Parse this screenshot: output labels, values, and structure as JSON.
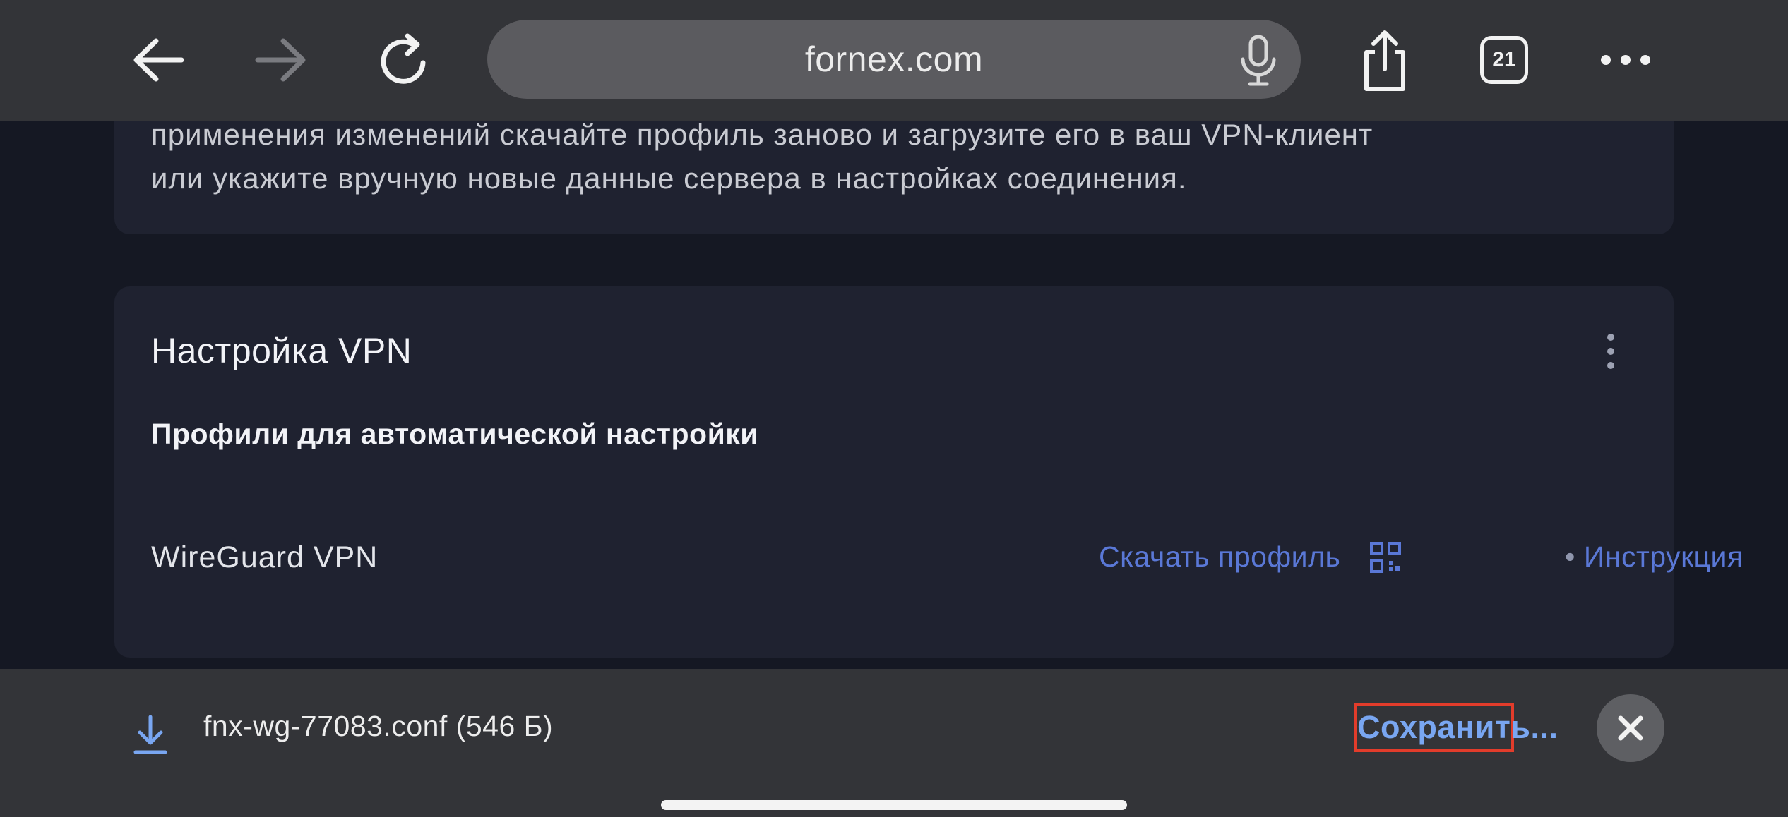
{
  "toolbar": {
    "url": "fornex.com",
    "tab_count": "21",
    "icons": [
      "back-arrow-icon",
      "forward-arrow-icon",
      "reload-icon",
      "microphone-icon",
      "share-icon",
      "tabs-icon",
      "more-icon"
    ]
  },
  "notice": {
    "text_line1": "применения изменений скачайте профиль заново и загрузите его в ваш VPN-клиент",
    "text_line2": "или укажите вручную новые данные сервера в настройках соединения."
  },
  "vpn_card": {
    "title": "Настройка VPN",
    "subtitle": "Профили для автоматической настройки",
    "row": {
      "name": "WireGuard VPN",
      "download_label": "Скачать профиль",
      "bullet": "•",
      "instruction_label": "Инструкция"
    }
  },
  "download_bar": {
    "filename": "fnx-wg-77083.conf (546 Б)",
    "save_label": "Сохранить..."
  },
  "colors": {
    "toolbar_bg": "#333438",
    "page_bg": "#151823",
    "card_bg": "#1f2230",
    "link": "#5a78d6",
    "save_text": "#79a6f1",
    "highlight_border": "#e23c2b"
  }
}
